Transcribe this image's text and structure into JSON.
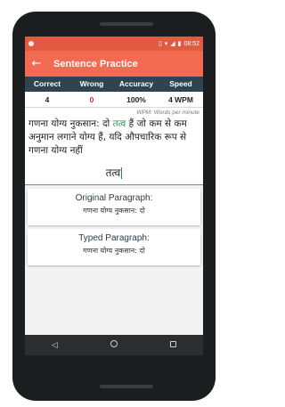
{
  "status_bar": {
    "time": "08:52",
    "icons": [
      "app-notification-icon",
      "vibrate-icon",
      "wifi-icon",
      "signal-icon",
      "battery-icon"
    ]
  },
  "app_bar": {
    "back_icon": "arrow-left-icon",
    "title": "Sentence Practice"
  },
  "stats": {
    "headers": [
      "Correct",
      "Wrong",
      "Accuracy",
      "Speed"
    ],
    "values": {
      "correct": "4",
      "wrong": "0",
      "accuracy": "100%",
      "speed": "4 WPM"
    }
  },
  "practice": {
    "wpm_note": "WPM: Words per minute",
    "paragraph_before": "गणना योग्य नुकसान: दो ",
    "paragraph_highlight": "तत्व",
    "paragraph_after": " हैं जो कम से कम अनुमान लगाने योग्य हैं, यदि औपचारिक रूप से गणना योग्य नहीं",
    "typed_text": "तत्व"
  },
  "original_card": {
    "label": "Original Paragraph:",
    "value": "गणना योग्य नुकसान: दो"
  },
  "typed_card": {
    "label": "Typed Paragraph:",
    "value": "गणना योग्य नुकसान: दो"
  },
  "nav_bar": {
    "icons": [
      "back-triangle-icon",
      "home-circle-icon",
      "recents-square-icon"
    ]
  },
  "colors": {
    "status_bar": "#e25a42",
    "app_bar": "#f26a4f",
    "stats_header": "#2e4450",
    "wrong_value": "#d32f2f",
    "highlight_word": "#2e8b57"
  }
}
